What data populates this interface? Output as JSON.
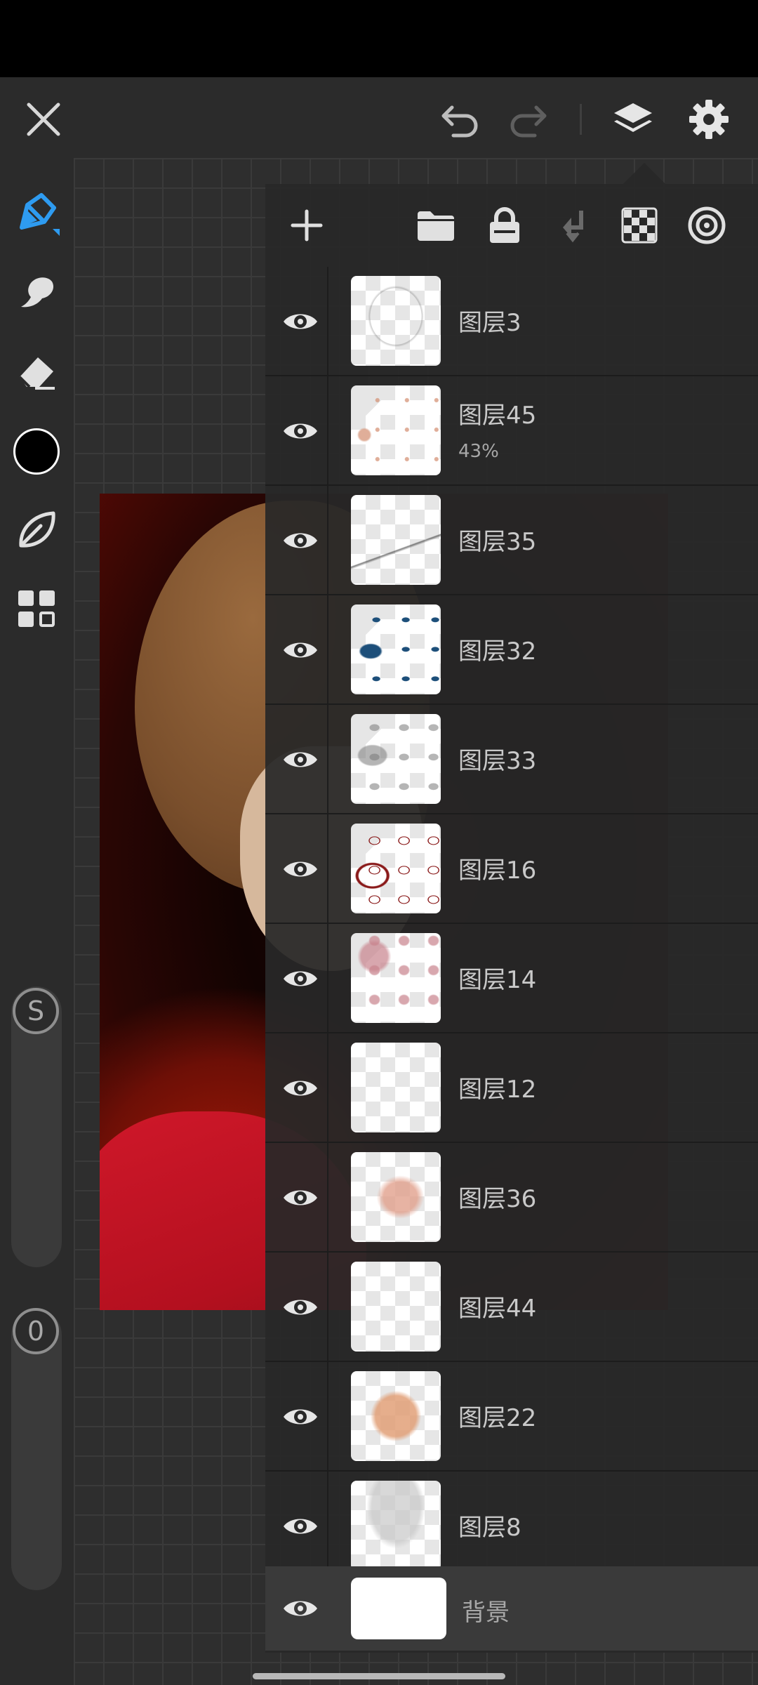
{
  "top_bar": {
    "close_icon": "close-icon",
    "undo_icon": "undo-icon",
    "redo_icon": "redo-icon",
    "layers_icon": "layers-icon",
    "settings_icon": "gear-icon"
  },
  "tools": [
    {
      "name": "brush-pen-tool",
      "icon": "pen-icon",
      "active": true
    },
    {
      "name": "smudge-tool",
      "icon": "smudge-icon"
    },
    {
      "name": "eraser-tool",
      "icon": "eraser-icon"
    },
    {
      "name": "color-picker",
      "icon": "color-swatch",
      "color": "#000000"
    },
    {
      "name": "fill-tool",
      "icon": "leaf-icon"
    },
    {
      "name": "material-tool",
      "icon": "grid-icon"
    }
  ],
  "sliders": {
    "size_label": "S",
    "opacity_label": "0"
  },
  "colors": {
    "accent": "#2e9bf0",
    "background": "#2b2b2b",
    "panel": "#282828"
  },
  "layers_panel": {
    "toolbar": [
      "add-icon",
      "folder-icon",
      "lock-icon",
      "merge-down-icon",
      "checkerboard-icon",
      "target-icon"
    ],
    "layers": [
      {
        "name": "图层3",
        "opacity": ""
      },
      {
        "name": "图层45",
        "opacity": "43%"
      },
      {
        "name": "图层35",
        "opacity": ""
      },
      {
        "name": "图层32",
        "opacity": ""
      },
      {
        "name": "图层33",
        "opacity": ""
      },
      {
        "name": "图层16",
        "opacity": ""
      },
      {
        "name": "图层14",
        "opacity": ""
      },
      {
        "name": "图层12",
        "opacity": ""
      },
      {
        "name": "图层36",
        "opacity": ""
      },
      {
        "name": "图层44",
        "opacity": ""
      },
      {
        "name": "图层22",
        "opacity": ""
      },
      {
        "name": "图层8",
        "opacity": ""
      }
    ],
    "background_layer": {
      "name": "背景"
    }
  }
}
